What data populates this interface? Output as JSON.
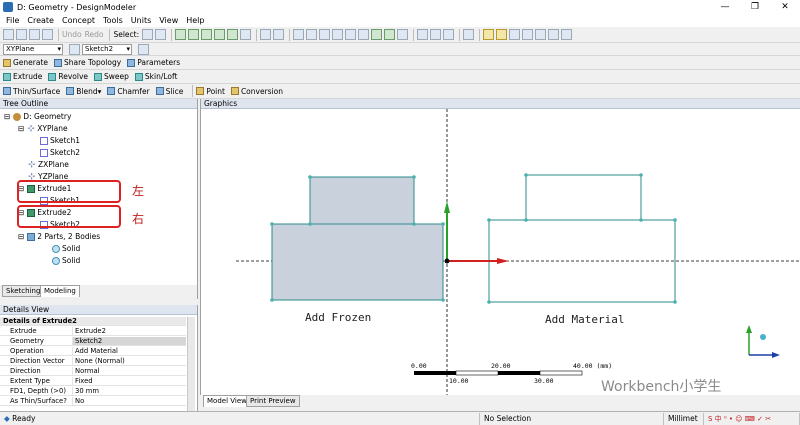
{
  "window": {
    "title": "D: Geometry - DesignModeler",
    "min": "—",
    "restore": "❐",
    "close": "✕"
  },
  "menu": [
    "File",
    "Create",
    "Concept",
    "Tools",
    "Units",
    "View",
    "Help"
  ],
  "toolbar1": {
    "undo": "Undo",
    "redo": "Redo",
    "select": "Select:"
  },
  "toolbar2": {
    "plane": "XYPlane",
    "sketch": "Sketch2"
  },
  "toolbar3": [
    "Generate",
    "Share Topology",
    "Parameters"
  ],
  "toolbar4": [
    "Extrude",
    "Revolve",
    "Sweep",
    "Skin/Loft"
  ],
  "toolbar5": [
    "Thin/Surface",
    "Blend",
    "Chamfer",
    "Slice",
    "Point",
    "Conversion"
  ],
  "panels": {
    "tree": "Tree Outline",
    "details": "Details View",
    "graphics": "Graphics"
  },
  "tree": {
    "root": "D: Geometry",
    "xyplane": "XYPlane",
    "sketch1": "Sketch1",
    "sketch2": "Sketch2",
    "zxplane": "ZXPlane",
    "yzplane": "YZPlane",
    "extrude1": "Extrude1",
    "extrude1_sketch": "Sketch1",
    "extrude2": "Extrude2",
    "extrude2_sketch": "Sketch2",
    "parts": "2 Parts, 2 Bodies",
    "solid1": "Solid",
    "solid2": "Solid"
  },
  "annotations": {
    "left": "左",
    "right": "右"
  },
  "tree_tabs": [
    "Sketching",
    "Modeling"
  ],
  "details": {
    "header": "Details of Extrude2",
    "rows": [
      [
        "Extrude",
        "Extrude2"
      ],
      [
        "Geometry",
        "Sketch2"
      ],
      [
        "Operation",
        "Add Material"
      ],
      [
        "Direction Vector",
        "None (Normal)"
      ],
      [
        "Direction",
        "Normal"
      ],
      [
        "Extent Type",
        "Fixed"
      ],
      [
        "FD1, Depth (>0)",
        "30 mm"
      ],
      [
        "As Thin/Surface?",
        "No"
      ]
    ]
  },
  "graphics": {
    "label_left": "Add Frozen",
    "label_right": "Add Material",
    "scale_top": [
      "0.00",
      "20.00",
      "40.00 (mm)"
    ],
    "scale_bottom": [
      "10.00",
      "30.00"
    ],
    "watermark": "Workbench小学生",
    "colors": {
      "frozen_fill": "#c9d2dc",
      "edge": "#2a8a8a",
      "vertex": "#4ab0b0"
    }
  },
  "graphics_tabs": [
    "Model View",
    "Print Preview"
  ],
  "status": {
    "ready": "Ready",
    "selection": "No Selection",
    "units": "Millimet"
  }
}
